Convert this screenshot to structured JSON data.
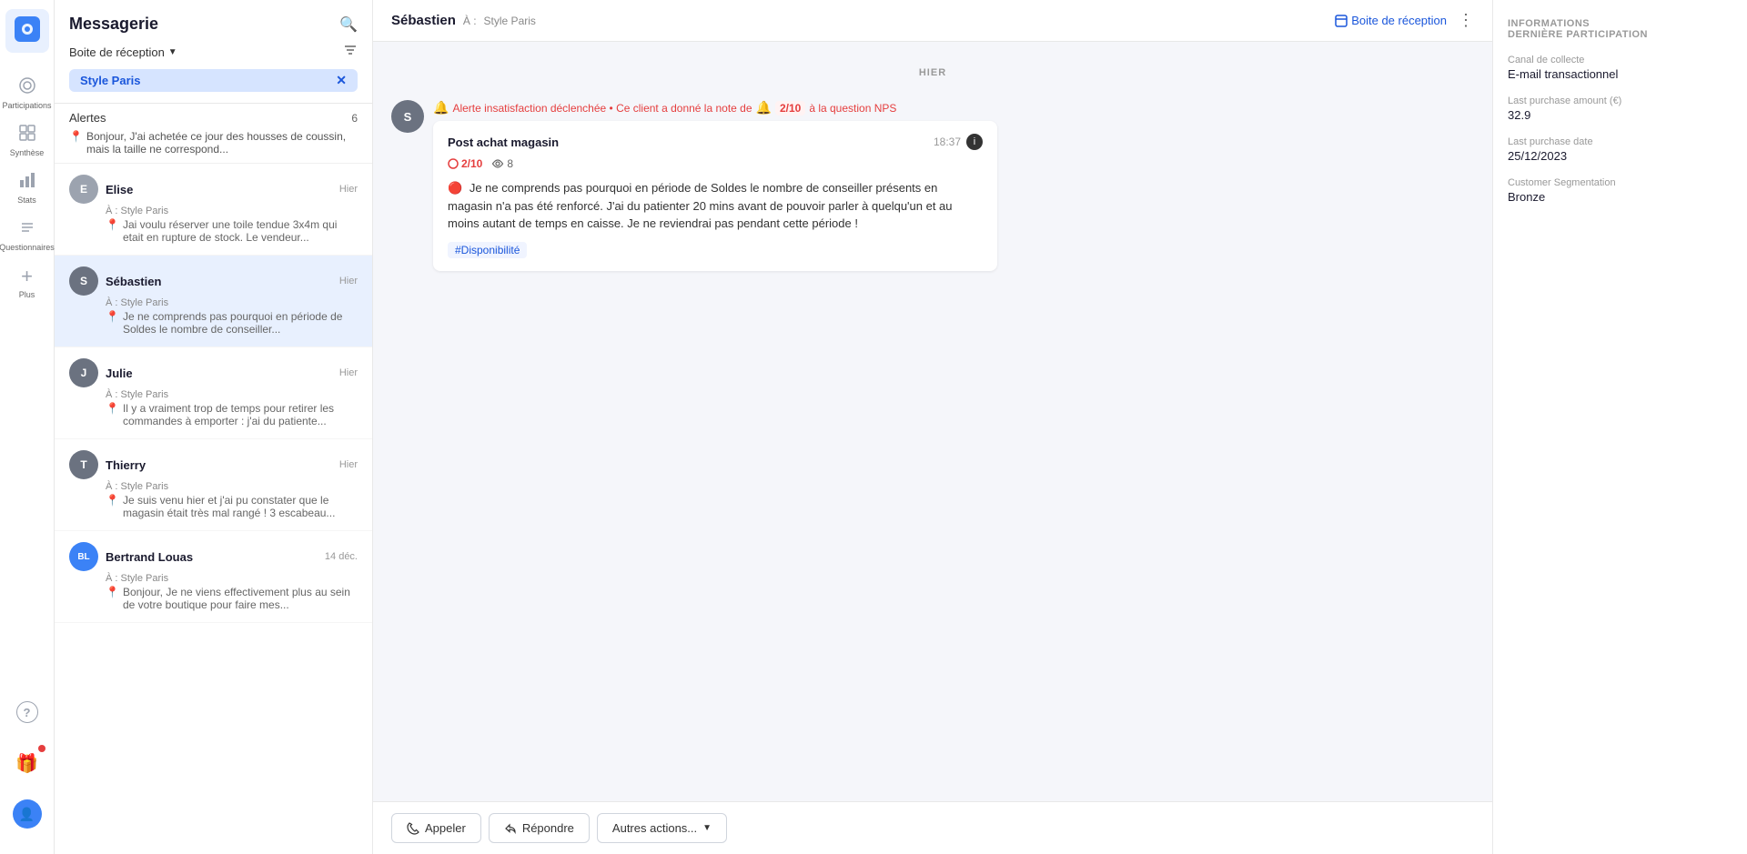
{
  "sidebar": {
    "icons": [
      {
        "id": "logo",
        "icon": "◉",
        "label": "",
        "active": false
      },
      {
        "id": "participations",
        "icon": "○",
        "label": "Participations",
        "active": false
      },
      {
        "id": "synthese",
        "icon": "⊞",
        "label": "Synthèse",
        "active": false
      },
      {
        "id": "stats",
        "icon": "📊",
        "label": "Stats",
        "active": false
      },
      {
        "id": "questionnaires",
        "icon": "☰",
        "label": "Questionnaires",
        "active": false
      },
      {
        "id": "plus",
        "icon": "+",
        "label": "Plus",
        "active": false
      }
    ],
    "bottom_icons": [
      {
        "id": "help",
        "icon": "?",
        "label": ""
      },
      {
        "id": "gift",
        "icon": "🎁",
        "label": ""
      },
      {
        "id": "avatar",
        "icon": "👤",
        "label": ""
      }
    ]
  },
  "panel": {
    "title": "Messagerie",
    "inbox_label": "Boite de réception",
    "active_filter": "Style Paris",
    "alerts_title": "Alertes",
    "alerts_count": "6",
    "alerts_preview": "Bonjour, J'ai achetée ce jour des housses de coussin, mais la taille ne correspond...",
    "conversations": [
      {
        "id": "elise",
        "initials": "E",
        "name": "Elise",
        "sub": "À : Style Paris",
        "time": "Hier",
        "preview": "Jai voulu réserver une toile tendue 3x4m qui etait en rupture de stock. Le vendeur...",
        "active": false
      },
      {
        "id": "sebastien",
        "initials": "S",
        "name": "Sébastien",
        "sub": "À : Style Paris",
        "time": "Hier",
        "preview": "Je ne comprends pas pourquoi en période de Soldes le nombre de conseiller...",
        "active": true
      },
      {
        "id": "julie",
        "initials": "J",
        "name": "Julie",
        "sub": "À : Style Paris",
        "time": "Hier",
        "preview": "Il y a vraiment trop de temps pour retirer les commandes à emporter : j'ai du patiente...",
        "active": false
      },
      {
        "id": "thierry",
        "initials": "T",
        "name": "Thierry",
        "sub": "À : Style Paris",
        "time": "Hier",
        "preview": "Je suis venu hier et j'ai pu constater que le magasin était très mal rangé ! 3 escabeau...",
        "active": false
      },
      {
        "id": "bertrand",
        "initials": "BL",
        "name": "Bertrand Louas",
        "sub": "À : Style Paris",
        "time": "14 déc.",
        "preview": "Bonjour, Je ne viens effectivement plus au sein de votre boutique pour faire mes...",
        "active": false
      }
    ]
  },
  "chat": {
    "header_name": "Sébastien",
    "header_arrow": "À : Style Paris",
    "date_divider": "HIER",
    "alert_text": "Alerte insatisfaction déclenchée • Ce client a donné la note de",
    "alert_score": "2/10",
    "alert_suffix": "à la question NPS",
    "message": {
      "title": "Post achat magasin",
      "time": "18:37",
      "score": "2/10",
      "views": "8",
      "body": "Je ne comprends pas pourquoi en période de Soldes le nombre de conseiller présents en magasin n'a pas été renforcé. J'ai du patienter 20 mins avant de pouvoir parler à quelqu'un et au moins autant de temps en caisse. Je ne reviendrai pas pendant cette période !",
      "tag": "#Disponibilité"
    },
    "actions": {
      "call": "Appeler",
      "reply": "Répondre",
      "more": "Autres actions..."
    }
  },
  "right_panel": {
    "section_title": "INFORMATIONS\nDERNIÈRE PARTICIPATION",
    "fields": [
      {
        "label": "Canal de collecte",
        "value": "E-mail transactionnel"
      },
      {
        "label": "Last purchase amount (€)",
        "value": "32.9"
      },
      {
        "label": "Last purchase date",
        "value": "25/12/2023"
      },
      {
        "label": "Customer Segmentation",
        "value": "Bronze"
      }
    ]
  },
  "top_bar": {
    "inbox_link": "Boite de réception",
    "more_icon": "⋮"
  }
}
